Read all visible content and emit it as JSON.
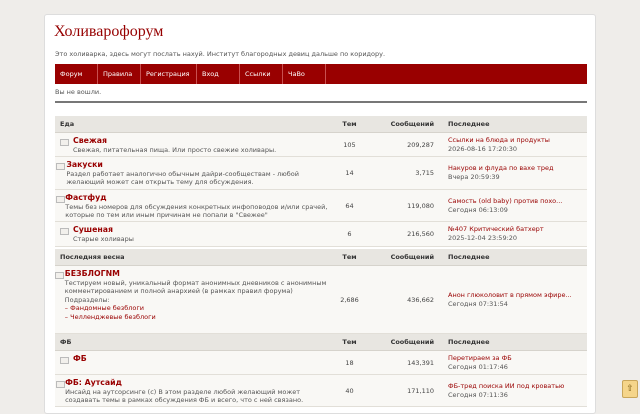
{
  "site": {
    "title": "Холиварофорум",
    "description": "Это холиварка, здесь могут послать нахуй. Институт благородных девиц дальше по коридору."
  },
  "nav": [
    "Форум",
    "Правила",
    "Регистрация",
    "Вход",
    "Ссылки",
    "ЧаВо"
  ],
  "status": "Вы не вошли.",
  "columns": {
    "topics": "Тем",
    "posts": "Сообщений",
    "last": "Последнее"
  },
  "categories": [
    {
      "name": "Еда",
      "forums": [
        {
          "name": "Свежая",
          "desc": "Свежая, питательная пища. Или просто свежие холивары.",
          "topics": "105",
          "posts": "209,287",
          "last_title": "Ссылки на блюда и продукты",
          "last_date": "2026-08-16 17:20:30"
        },
        {
          "name": "Закуски",
          "desc": "Раздел работает аналогично обычным дайри-сообществам - любой желающий может сам открыть тему для обсуждения.",
          "topics": "14",
          "posts": "3,715",
          "last_title": "Накуров и флуда по вахе тред",
          "last_date": "Вчера 20:59:39"
        },
        {
          "name": "Фастфуд",
          "desc": "Темы без номеров для обсуждения конкретных инфоповодов и/или срачей, которые по тем или иным причинам не попали в \"Свежее\"",
          "topics": "64",
          "posts": "119,080",
          "last_title": "Самость (old baby) против похо...",
          "last_date": "Сегодня 06:13:09"
        },
        {
          "name": "Сушеная",
          "desc": "Старые холивары",
          "topics": "6",
          "posts": "216,560",
          "last_title": "№407 Критический батхерт",
          "last_date": "2025-12-04 23:59:20"
        }
      ]
    },
    {
      "name": "Последняя весна",
      "forums": [
        {
          "name": "БЕЗБЛОГNM",
          "desc": "Тестируем новый, уникальный формат анонимных дневников с анонимным комментированием и полной анархией (в рамках правил форума)",
          "sub_label": "Подразделы:",
          "subforums": [
            "Фандомные безблоги",
            "Челленджевые безблоги"
          ],
          "topics": "2,686",
          "posts": "436,662",
          "last_title": "Анон глюколовит в прямом эфире...",
          "last_date": "Сегодня 07:31:54"
        }
      ]
    },
    {
      "name": "ФБ",
      "forums": [
        {
          "name": "ФБ",
          "desc": "",
          "topics": "18",
          "posts": "143,391",
          "last_title": "Перетираем за ФБ",
          "last_date": "Сегодня 01:17:46"
        },
        {
          "name": "ФБ: Аутсайд",
          "desc": "Инсайд на аутсорсинге (с) В этом разделе любой желающий может создавать темы в рамках обсуждения ФБ и всего, что с ней связано.",
          "topics": "40",
          "posts": "171,110",
          "last_title": "ФБ-тред поиска ИИ под кроватью",
          "last_date": "Сегодня 07:11:36"
        }
      ]
    }
  ],
  "scroll_button": "⇧"
}
